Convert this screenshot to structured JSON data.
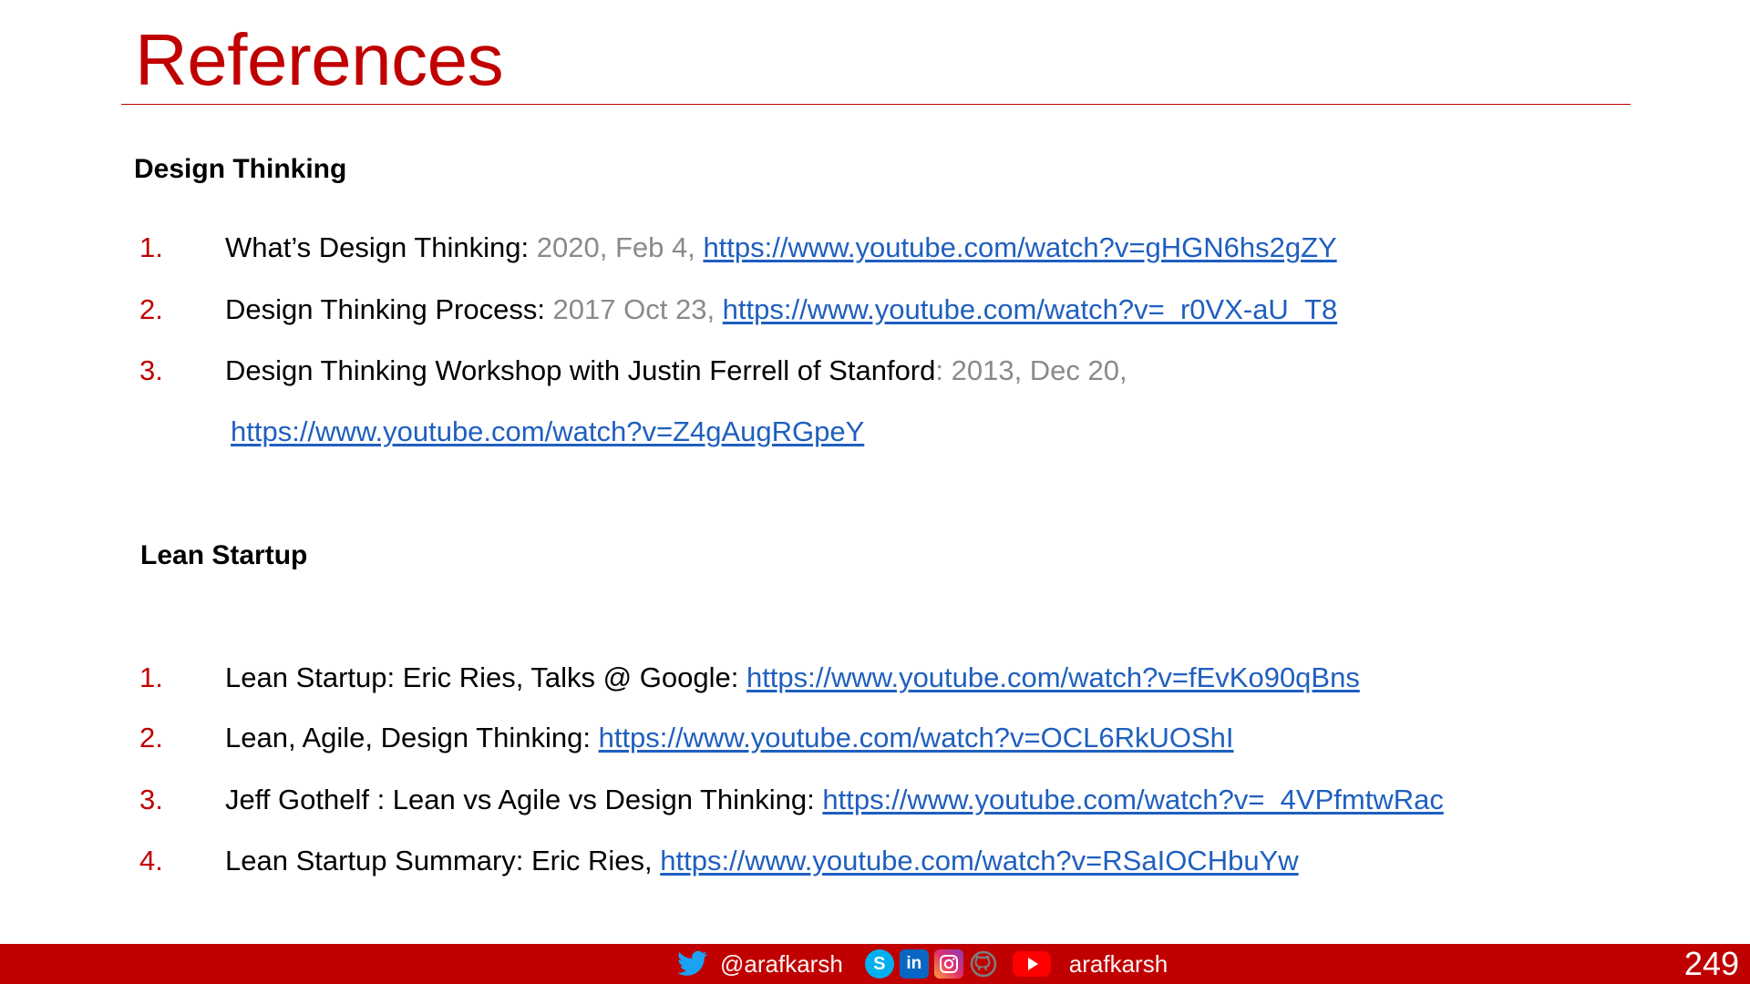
{
  "slide": {
    "title": "References",
    "page_number": "249"
  },
  "design_thinking": {
    "heading": "Design Thinking",
    "items": [
      {
        "num": "1.",
        "title": "What’s Design Thinking: ",
        "date": "2020, Feb 4, ",
        "link": "https://www.youtube.com/watch?v=gHGN6hs2gZY"
      },
      {
        "num": "2.",
        "title": "Design Thinking Process: ",
        "date": "2017 Oct 23, ",
        "link": "https://www.youtube.com/watch?v=_r0VX-aU_T8"
      },
      {
        "num": "3.",
        "title": "Design Thinking Workshop with Justin Ferrell of Stanford",
        "date": ": 2013, Dec 20,",
        "link": "https://www.youtube.com/watch?v=Z4gAugRGpeY"
      }
    ]
  },
  "lean_startup": {
    "heading": "Lean Startup",
    "items": [
      {
        "num": "1.",
        "title": "Lean Startup: Eric Ries, Talks @ Google: ",
        "link": "https://www.youtube.com/watch?v=fEvKo90qBns"
      },
      {
        "num": "2.",
        "title": "Lean, Agile, Design Thinking: ",
        "link": "https://www.youtube.com/watch?v=OCL6RkUOShI"
      },
      {
        "num": "3.",
        "title": "Jeff Gothelf : Lean vs Agile vs Design Thinking: ",
        "link": "https://www.youtube.com/watch?v=_4VPfmtwRac"
      },
      {
        "num": "4.",
        "title": "Lean Startup Summary: Eric Ries, ",
        "link": "https://www.youtube.com/watch?v=RSaIOCHbuYw"
      }
    ]
  },
  "footer": {
    "twitter_handle": "@arafkarsh",
    "youtube_handle": "arafkarsh",
    "icons": [
      "twitter-icon",
      "skype-icon",
      "linkedin-icon",
      "instagram-icon",
      "github-icon",
      "youtube-icon"
    ],
    "colors": {
      "bar": "#c00000",
      "twitter": "#1da1f2",
      "skype": "#00aff0",
      "linkedin": "#0a66c2",
      "youtube": "#ff0000"
    }
  },
  "colors": {
    "accent": "#c00000",
    "link": "#1f5fbf",
    "date": "#8a8a8a"
  }
}
